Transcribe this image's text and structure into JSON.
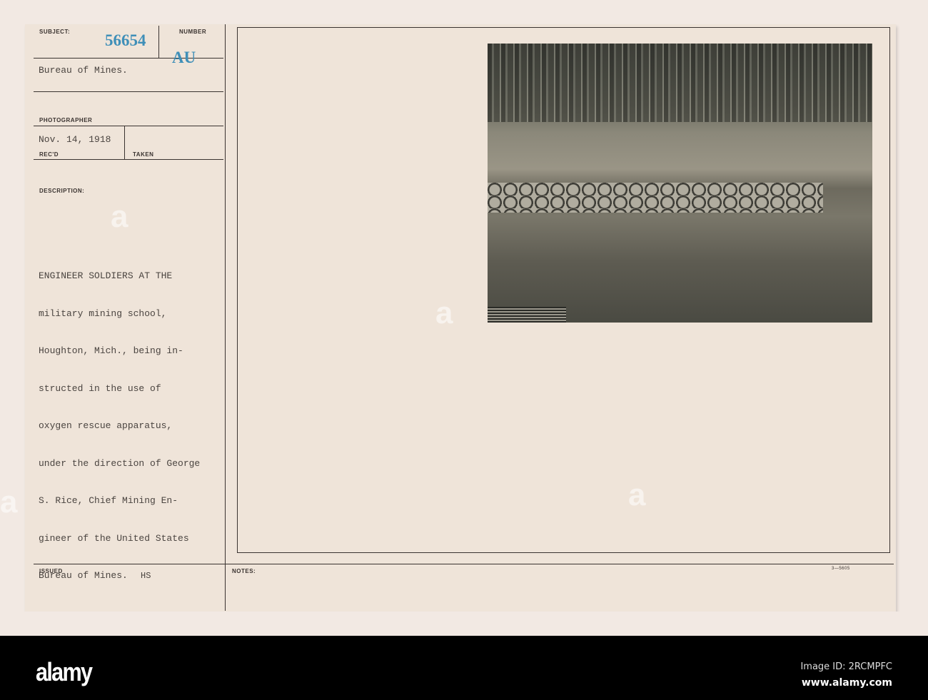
{
  "card": {
    "subject_label": "SUBJECT:",
    "number_label": "NUMBER",
    "number_value": "56654",
    "number_stamp": "AU",
    "subject_value": "Bureau of Mines.",
    "photographer_label": "PHOTOGRAPHER",
    "recd_date": "Nov. 14, 1918",
    "recd_label": "REC'D",
    "taken_label": "TAKEN",
    "description_label": "DESCRIPTION:",
    "description_lines": [
      "ENGINEER SOLDIERS AT THE",
      "military mining school,",
      "Houghton, Mich., being in-",
      "structed in the use of",
      "oxygen rescue apparatus,",
      "under the direction of George",
      "S. Rice, Chief Mining En-",
      "gineer of the United States",
      "Bureau of Mines."
    ],
    "issued_label": "ISSUED",
    "issued_value": "HS",
    "notes_label": "NOTES:",
    "form_number": "3—5605"
  },
  "watermark": "alamy",
  "footer": {
    "logo": "alamy",
    "image_id": "Image ID: 2RCMPFC",
    "url": "www.alamy.com"
  }
}
